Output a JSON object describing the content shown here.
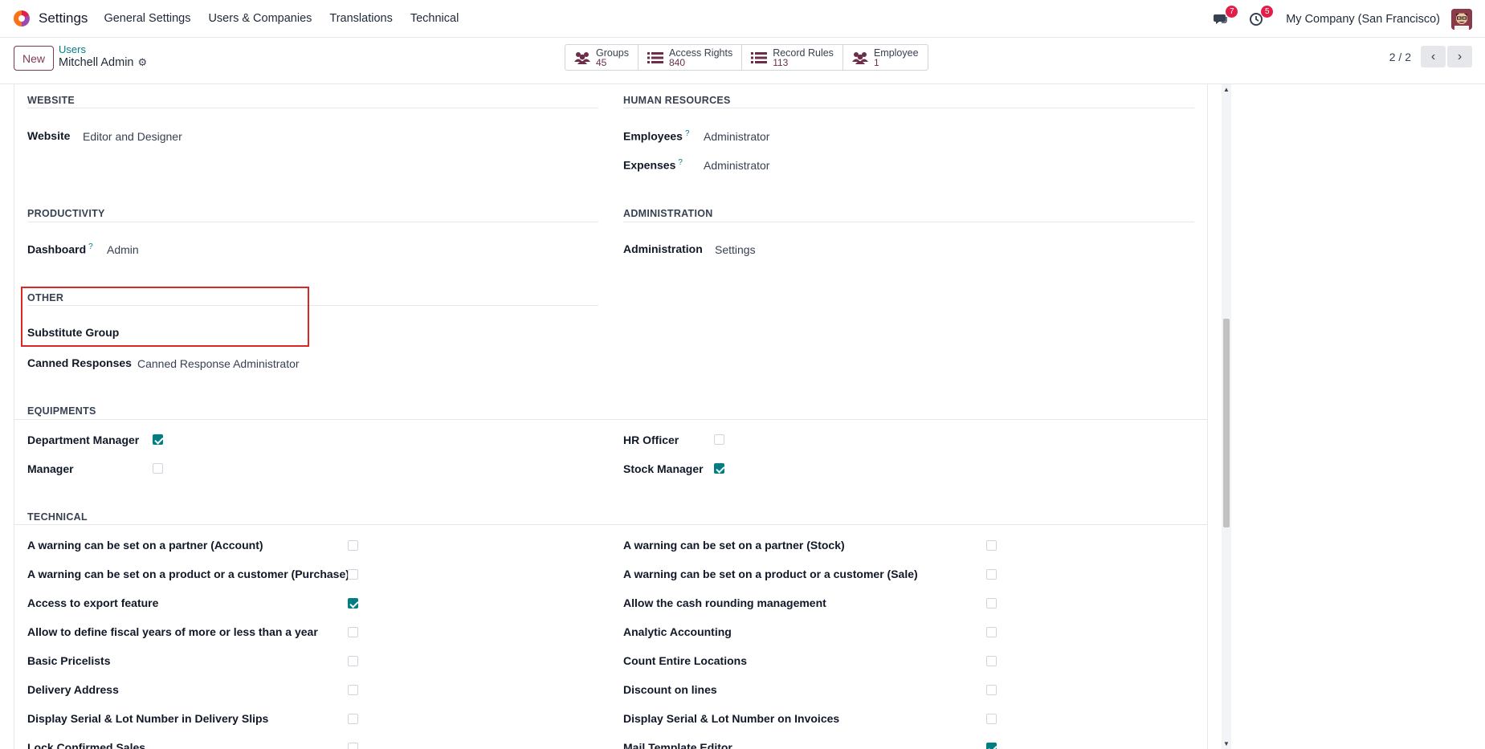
{
  "topnav": {
    "app_title": "Settings",
    "menu": [
      "General Settings",
      "Users & Companies",
      "Translations",
      "Technical"
    ],
    "messages_badge": "7",
    "activities_badge": "5",
    "company": "My Company (San Francisco)"
  },
  "control_panel": {
    "new_label": "New",
    "breadcrumb_parent": "Users",
    "breadcrumb_current": "Mitchell Admin",
    "smart_buttons": [
      {
        "label": "Groups",
        "value": "45",
        "icon": "users-icon"
      },
      {
        "label": "Access Rights",
        "value": "840",
        "icon": "list-icon"
      },
      {
        "label": "Record Rules",
        "value": "113",
        "icon": "list-icon"
      },
      {
        "label": "Employee",
        "value": "1",
        "icon": "users-icon"
      }
    ],
    "pager": "2 / 2"
  },
  "sections": {
    "website": {
      "title": "WEBSITE",
      "fields": [
        {
          "label": "Website",
          "value": "Editor and Designer"
        }
      ]
    },
    "human_resources": {
      "title": "HUMAN RESOURCES",
      "fields": [
        {
          "label": "Employees",
          "help": "?",
          "value": "Administrator"
        },
        {
          "label": "Expenses",
          "help": "?",
          "value": "Administrator"
        }
      ]
    },
    "productivity": {
      "title": "PRODUCTIVITY",
      "fields": [
        {
          "label": "Dashboard",
          "help": "?",
          "value": "Admin"
        }
      ]
    },
    "administration": {
      "title": "ADMINISTRATION",
      "fields": [
        {
          "label": "Administration",
          "value": "Settings"
        }
      ]
    },
    "other": {
      "title": "OTHER",
      "fields": [
        {
          "label": "Substitute Group",
          "value": ""
        },
        {
          "label": "Canned Responses",
          "value": "Canned Response Administrator"
        }
      ]
    },
    "equipments": {
      "title": "EQUIPMENTS",
      "fields": [
        {
          "label": "Department Manager",
          "checked": true
        },
        {
          "label": "Manager",
          "checked": false
        },
        {
          "label": "HR Officer",
          "checked": false
        },
        {
          "label": "Stock Manager",
          "checked": true
        }
      ]
    },
    "technical": {
      "title": "TECHNICAL",
      "left": [
        {
          "label": "A warning can be set on a partner (Account)",
          "checked": false
        },
        {
          "label": "A warning can be set on a product or a customer (Purchase)",
          "checked": false
        },
        {
          "label": "Access to export feature",
          "checked": true
        },
        {
          "label": "Allow to define fiscal years of more or less than a year",
          "checked": false
        },
        {
          "label": "Basic Pricelists",
          "checked": false
        },
        {
          "label": "Delivery Address",
          "checked": false
        },
        {
          "label": "Display Serial & Lot Number in Delivery Slips",
          "checked": false
        },
        {
          "label": "Lock Confirmed Sales",
          "checked": false
        }
      ],
      "right": [
        {
          "label": "A warning can be set on a partner (Stock)",
          "checked": false
        },
        {
          "label": "A warning can be set on a product or a customer (Sale)",
          "checked": false
        },
        {
          "label": "Allow the cash rounding management",
          "checked": false
        },
        {
          "label": "Analytic Accounting",
          "checked": false
        },
        {
          "label": "Count Entire Locations",
          "checked": false
        },
        {
          "label": "Discount on lines",
          "checked": false
        },
        {
          "label": "Display Serial & Lot Number on Invoices",
          "checked": false
        },
        {
          "label": "Mail Template Editor",
          "checked": true
        }
      ]
    }
  }
}
